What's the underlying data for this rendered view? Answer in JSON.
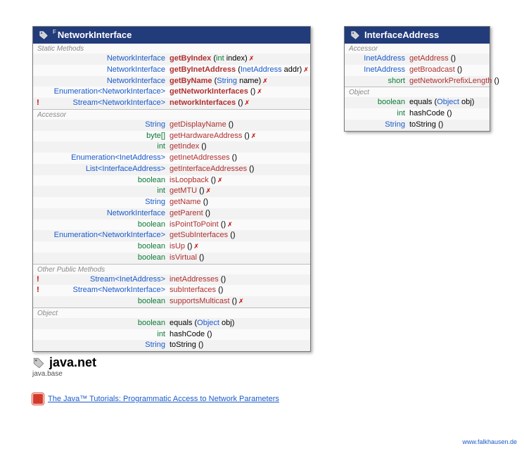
{
  "left": {
    "titleSup": "F",
    "title": "NetworkInterface",
    "sections": [
      {
        "label": "Static Methods",
        "rows": [
          {
            "flag": "",
            "retClass": "c-type",
            "ret": "NetworkInterface",
            "nameClass": "c-name-bold",
            "name": "getByIndex",
            "paramsHtml": " (<span class='c-prim'>int</span> index)",
            "mark": "✗"
          },
          {
            "flag": "",
            "retClass": "c-type",
            "ret": "NetworkInterface",
            "nameClass": "c-name-bold",
            "name": "getByInetAddress",
            "paramsHtml": " (<span class='c-type'>InetAddress</span> addr)",
            "mark": "✗"
          },
          {
            "flag": "",
            "retClass": "c-type",
            "ret": "NetworkInterface",
            "nameClass": "c-name-bold",
            "name": "getByName",
            "paramsHtml": " (<span class='c-type'>String</span> name)",
            "mark": "✗"
          },
          {
            "flag": "",
            "retClass": "c-type",
            "ret": "Enumeration<NetworkInterface>",
            "nameClass": "c-name-bold",
            "name": "getNetworkInterfaces",
            "paramsHtml": " ()",
            "mark": "✗"
          },
          {
            "flag": "!",
            "retClass": "c-type",
            "ret": "Stream<NetworkInterface>",
            "nameClass": "c-name-bold",
            "name": "networkInterfaces",
            "paramsHtml": " ()",
            "mark": "✗"
          }
        ]
      },
      {
        "label": "Accessor",
        "rows": [
          {
            "flag": "",
            "retClass": "c-type",
            "ret": "String",
            "nameClass": "c-name",
            "name": "getDisplayName",
            "paramsHtml": " ()",
            "mark": ""
          },
          {
            "flag": "",
            "retClass": "c-prim",
            "ret": "byte[]",
            "nameClass": "c-name",
            "name": "getHardwareAddress",
            "paramsHtml": " ()",
            "mark": "✗"
          },
          {
            "flag": "",
            "retClass": "c-prim",
            "ret": "int",
            "nameClass": "c-name",
            "name": "getIndex",
            "paramsHtml": " ()",
            "mark": ""
          },
          {
            "flag": "",
            "retClass": "c-type",
            "ret": "Enumeration<InetAddress>",
            "nameClass": "c-name",
            "name": "getInetAddresses",
            "paramsHtml": " ()",
            "mark": ""
          },
          {
            "flag": "",
            "retClass": "c-type",
            "ret": "List<InterfaceAddress>",
            "nameClass": "c-name",
            "name": "getInterfaceAddresses",
            "paramsHtml": " ()",
            "mark": ""
          },
          {
            "flag": "",
            "retClass": "c-prim",
            "ret": "boolean",
            "nameClass": "c-name",
            "name": "isLoopback",
            "paramsHtml": " ()",
            "mark": "✗"
          },
          {
            "flag": "",
            "retClass": "c-prim",
            "ret": "int",
            "nameClass": "c-name",
            "name": "getMTU",
            "paramsHtml": " ()",
            "mark": "✗"
          },
          {
            "flag": "",
            "retClass": "c-type",
            "ret": "String",
            "nameClass": "c-name",
            "name": "getName",
            "paramsHtml": " ()",
            "mark": ""
          },
          {
            "flag": "",
            "retClass": "c-type",
            "ret": "NetworkInterface",
            "nameClass": "c-name",
            "name": "getParent",
            "paramsHtml": " ()",
            "mark": ""
          },
          {
            "flag": "",
            "retClass": "c-prim",
            "ret": "boolean",
            "nameClass": "c-name",
            "name": "isPointToPoint",
            "paramsHtml": " ()",
            "mark": "✗"
          },
          {
            "flag": "",
            "retClass": "c-type",
            "ret": "Enumeration<NetworkInterface>",
            "nameClass": "c-name",
            "name": "getSubInterfaces",
            "paramsHtml": " ()",
            "mark": ""
          },
          {
            "flag": "",
            "retClass": "c-prim",
            "ret": "boolean",
            "nameClass": "c-name",
            "name": "isUp",
            "paramsHtml": " ()",
            "mark": "✗"
          },
          {
            "flag": "",
            "retClass": "c-prim",
            "ret": "boolean",
            "nameClass": "c-name",
            "name": "isVirtual",
            "paramsHtml": " ()",
            "mark": ""
          }
        ]
      },
      {
        "label": "Other Public Methods",
        "rows": [
          {
            "flag": "!",
            "retClass": "c-type",
            "ret": "Stream<InetAddress>",
            "nameClass": "c-name",
            "name": "inetAddresses",
            "paramsHtml": " ()",
            "mark": ""
          },
          {
            "flag": "!",
            "retClass": "c-type",
            "ret": "Stream<NetworkInterface>",
            "nameClass": "c-name",
            "name": "subInterfaces",
            "paramsHtml": " ()",
            "mark": ""
          },
          {
            "flag": "",
            "retClass": "c-prim",
            "ret": "boolean",
            "nameClass": "c-name",
            "name": "supportsMulticast",
            "paramsHtml": " ()",
            "mark": "✗"
          }
        ]
      },
      {
        "label": "Object",
        "rows": [
          {
            "flag": "",
            "retClass": "c-prim",
            "ret": "boolean",
            "nameClass": "c-black",
            "name": "equals",
            "paramsHtml": " (<span class='c-type'>Object</span> obj)",
            "mark": ""
          },
          {
            "flag": "",
            "retClass": "c-prim",
            "ret": "int",
            "nameClass": "c-black",
            "name": "hashCode",
            "paramsHtml": " ()",
            "mark": ""
          },
          {
            "flag": "",
            "retClass": "c-type",
            "ret": "String",
            "nameClass": "c-black",
            "name": "toString",
            "paramsHtml": " ()",
            "mark": ""
          }
        ]
      }
    ]
  },
  "right": {
    "title": "InterfaceAddress",
    "sections": [
      {
        "label": "Accessor",
        "rows": [
          {
            "flag": "",
            "retClass": "c-type",
            "ret": "InetAddress",
            "nameClass": "c-name",
            "name": "getAddress",
            "paramsHtml": " ()",
            "mark": ""
          },
          {
            "flag": "",
            "retClass": "c-type",
            "ret": "InetAddress",
            "nameClass": "c-name",
            "name": "getBroadcast",
            "paramsHtml": " ()",
            "mark": ""
          },
          {
            "flag": "",
            "retClass": "c-prim",
            "ret": "short",
            "nameClass": "c-name",
            "name": "getNetworkPrefixLength",
            "paramsHtml": " ()",
            "mark": ""
          }
        ]
      },
      {
        "label": "Object",
        "rows": [
          {
            "flag": "",
            "retClass": "c-prim",
            "ret": "boolean",
            "nameClass": "c-black",
            "name": "equals",
            "paramsHtml": " (<span class='c-type'>Object</span> obj)",
            "mark": ""
          },
          {
            "flag": "",
            "retClass": "c-prim",
            "ret": "int",
            "nameClass": "c-black",
            "name": "hashCode",
            "paramsHtml": " ()",
            "mark": ""
          },
          {
            "flag": "",
            "retClass": "c-type",
            "ret": "String",
            "nameClass": "c-black",
            "name": "toString",
            "paramsHtml": " ()",
            "mark": ""
          }
        ]
      }
    ]
  },
  "footer": {
    "package": "java.net",
    "module": "java.base",
    "tutorial": "The Java™ Tutorials: Programmatic Access to Network Parameters",
    "credit": "www.falkhausen.de"
  }
}
